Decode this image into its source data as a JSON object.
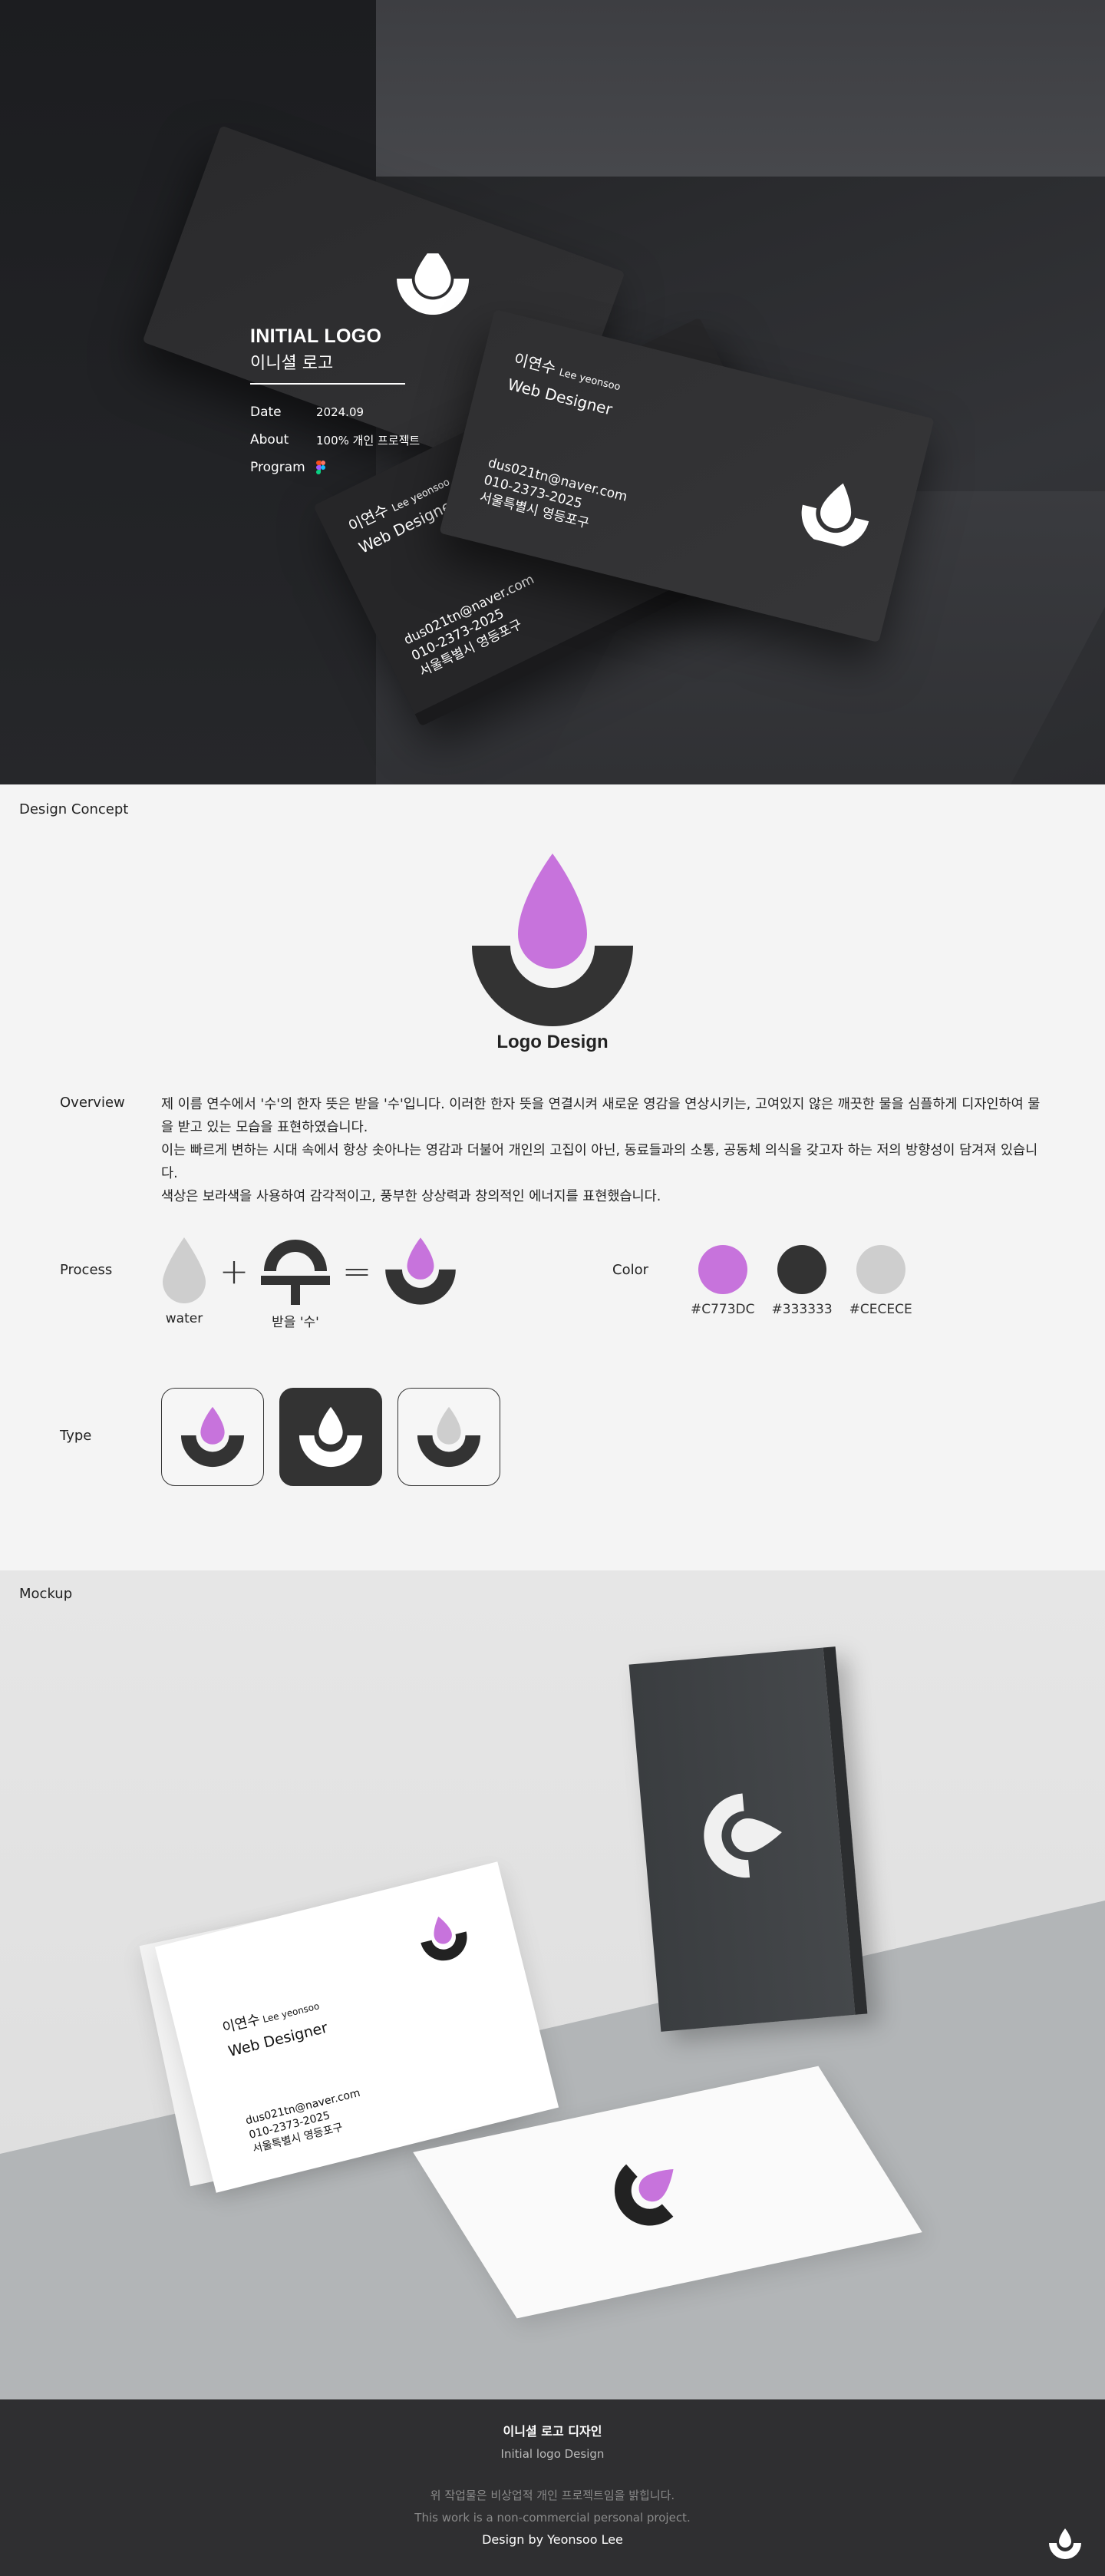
{
  "hero": {
    "title": "INITIAL LOGO",
    "subtitle": "이니셜 로고",
    "rows": [
      {
        "key": "Date",
        "value": "2024.09"
      },
      {
        "key": "About",
        "value": "100% 개인 프로젝트"
      },
      {
        "key": "Program",
        "value": ""
      }
    ],
    "card": {
      "name": "이연수",
      "name_en": "Lee yeonsoo",
      "role": "Web Designer",
      "email": "dus021tn@naver.com",
      "phone": "010-2373-2025",
      "address": "서울특별시 영등포구"
    }
  },
  "concept": {
    "section_label": "Design Concept",
    "logo_title": "Logo Design",
    "overview_label": "Overview",
    "overview": [
      " 제 이름 연수에서 '수'의 한자 뜻은 받을 '수'입니다. 이러한 한자 뜻을 연결시켜 새로운 영감을 연상시키는, 고여있지 않은 깨끗한 물을 심플하게 디자인하여 물을 받고 있는 모습을 표현하였습니다.",
      "이는 빠르게 변하는 시대 속에서 항상 솟아나는 영감과 더불어 개인의 고집이 아닌, 동료들과의 소통, 공동체 의식을 갖고자 하는 저의 방향성이 담겨져 있습니다.",
      " 색상은 보라색을 사용하여 감각적이고, 풍부한 상상력과 창의적인 에너지를 표현했습니다."
    ],
    "process_label": "Process",
    "process": {
      "water_label": "water",
      "su_label": "받을 '수'",
      "plus": "+",
      "equals": "="
    },
    "color_label": "Color",
    "colors": [
      {
        "hex": "#C773DC",
        "label": "#C773DC"
      },
      {
        "hex": "#333333",
        "label": "#333333"
      },
      {
        "hex": "#CECECE",
        "label": "#CECECE"
      }
    ],
    "type_label": "Type"
  },
  "mockup": {
    "section_label": "Mockup",
    "card": {
      "name": "이연수",
      "name_en": "Lee yeonsoo",
      "role": "Web Designer",
      "email": "dus021tn@naver.com",
      "phone": "010-2373-2025",
      "address": "서울특별시 영등포구"
    }
  },
  "footer": {
    "title": "이니셜 로고 디자인",
    "subtitle": "Initial logo Design",
    "notice_ko": "위 작업물은 비상업적 개인 프로젝트임을 밝힙니다.",
    "notice_en": "This work is a non-commercial personal project.",
    "credit": "Design by Yeonsoo Lee"
  },
  "theme": {
    "purple": "#C773DC",
    "dark": "#333333",
    "light": "#CECECE"
  }
}
